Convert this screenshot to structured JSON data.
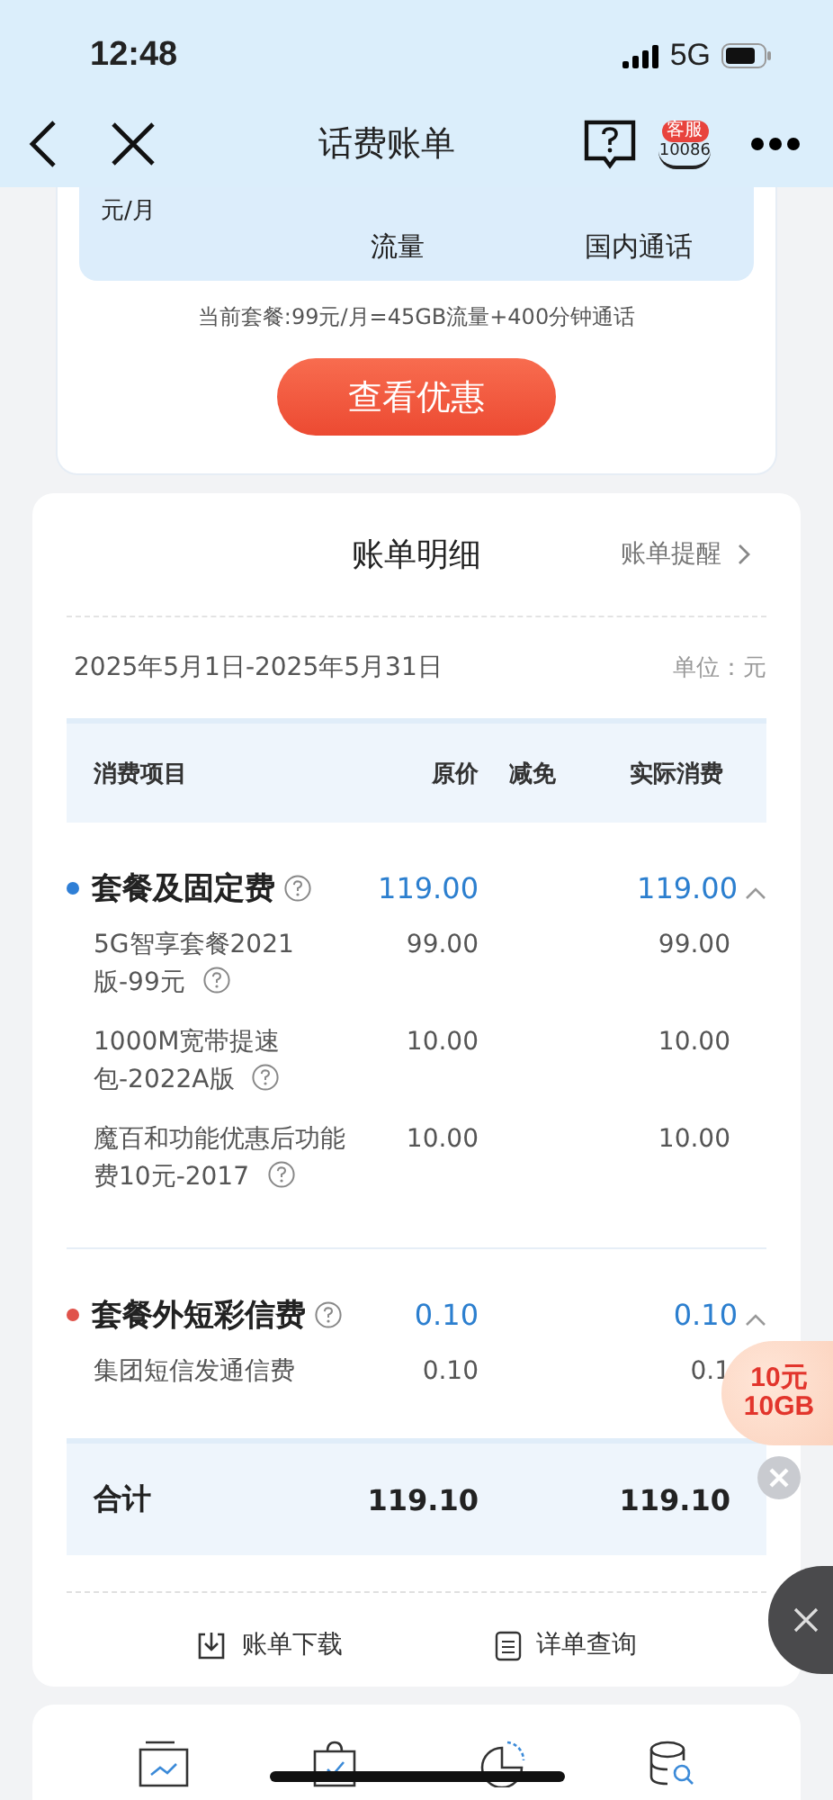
{
  "status_bar": {
    "time": "12:48",
    "network": "5G"
  },
  "nav": {
    "title": "话费账单",
    "service_badge": "客服",
    "service_number": "10086"
  },
  "plan_summary": {
    "price_unit": "元/月",
    "stats": [
      {
        "label": "流量"
      },
      {
        "label": "国内通话"
      }
    ],
    "current_plan": "当前套餐:99元/月=45GB流量+400分钟通话",
    "offer_button": "查看优惠"
  },
  "bill_detail": {
    "title": "账单明细",
    "reminder_link": "账单提醒",
    "period": "2025年5月1日-2025年5月31日",
    "unit": "单位：元",
    "columns": [
      "消费项目",
      "原价",
      "减免",
      "实际消费"
    ],
    "groups": [
      {
        "name": "套餐及固定费",
        "color": "#2f7fd6",
        "original": "119.00",
        "actual": "119.00",
        "expanded": true,
        "items": [
          {
            "name": "5G智享套餐2021版-99元",
            "original": "99.00",
            "actual": "99.00",
            "info": true
          },
          {
            "name": "1000M宽带提速包-2022A版",
            "original": "10.00",
            "actual": "10.00",
            "info": true
          },
          {
            "name": "魔百和功能优惠后功能费10元-2017",
            "original": "10.00",
            "actual": "10.00",
            "info": true
          }
        ]
      },
      {
        "name": "套餐外短彩信费",
        "color": "#e0524a",
        "original": "0.10",
        "actual": "0.10",
        "expanded": true,
        "items": [
          {
            "name": "集团短信发通信费",
            "original": "0.10",
            "actual": "0.1",
            "info": false
          }
        ]
      }
    ],
    "total": {
      "label": "合计",
      "original": "119.10",
      "actual": "119.10"
    },
    "actions": [
      {
        "label": "账单下载",
        "kind": "download"
      },
      {
        "label": "详单查询",
        "kind": "list"
      }
    ]
  },
  "promo": {
    "line1": "10元",
    "line2": "10GB"
  }
}
